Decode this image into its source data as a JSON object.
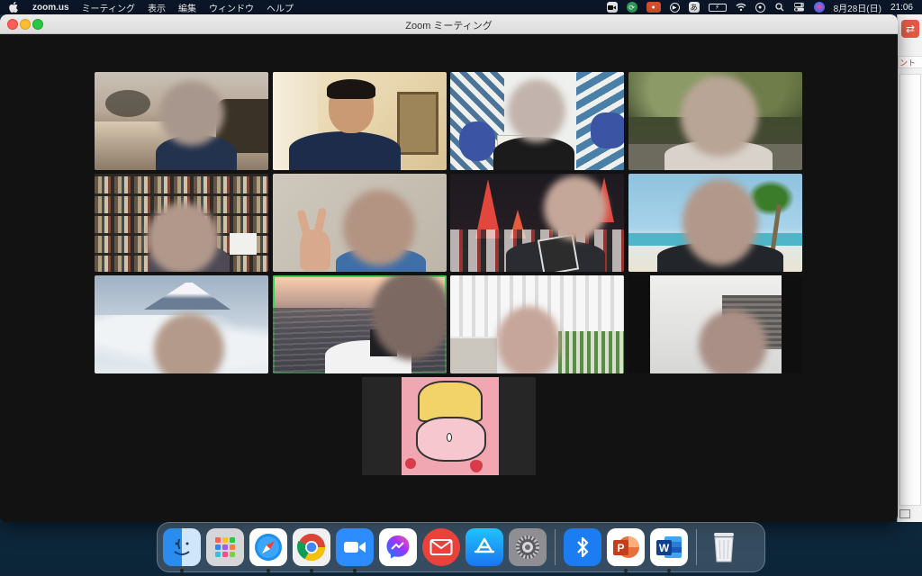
{
  "menubar": {
    "app_name": "zoom.us",
    "menus": [
      "ミーティング",
      "表示",
      "編集",
      "ウィンドウ",
      "ヘルプ"
    ],
    "status_icons": [
      "camera-icon",
      "sync-icon",
      "mic-indicator-icon",
      "play-circle-icon",
      "input-method-icon",
      "battery-icon",
      "wifi-icon",
      "user-icon",
      "spotlight-icon",
      "control-center-icon",
      "siri-icon"
    ],
    "date": "8月28日(日)",
    "time": "21:06"
  },
  "zoom_window": {
    "title": "Zoom ミーティング",
    "participants": [
      {
        "row": 1,
        "col": 1,
        "background": "sunset-bay"
      },
      {
        "row": 1,
        "col": 2,
        "background": "room"
      },
      {
        "row": 1,
        "col": 3,
        "background": "leaf-pattern"
      },
      {
        "row": 1,
        "col": 4,
        "background": "forest"
      },
      {
        "row": 2,
        "col": 1,
        "background": "bookshelf"
      },
      {
        "row": 2,
        "col": 2,
        "background": "plain-wall"
      },
      {
        "row": 2,
        "col": 3,
        "background": "lantern-festival"
      },
      {
        "row": 2,
        "col": 4,
        "background": "tropical-beach"
      },
      {
        "row": 3,
        "col": 1,
        "background": "mount-fuji"
      },
      {
        "row": 3,
        "col": 2,
        "background": "ocean-sunset",
        "active_speaker": true
      },
      {
        "row": 3,
        "col": 3,
        "background": "curtain"
      },
      {
        "row": 3,
        "col": 4,
        "background": "dark-room"
      },
      {
        "row": 4,
        "col": 1,
        "background": "pink-cartoon"
      }
    ]
  },
  "background_window": {
    "tab_label": "ント"
  },
  "dock": {
    "apps": [
      {
        "name": "Finder",
        "icon": "finder-icon",
        "running": true
      },
      {
        "name": "Launchpad",
        "icon": "launchpad-icon",
        "running": false
      },
      {
        "name": "Safari",
        "icon": "safari-icon",
        "running": true
      },
      {
        "name": "Google Chrome",
        "icon": "chrome-icon",
        "running": true
      },
      {
        "name": "Zoom",
        "icon": "zoom-icon",
        "running": true
      },
      {
        "name": "Messenger",
        "icon": "messenger-icon",
        "running": false
      },
      {
        "name": "Mail",
        "icon": "mail-icon",
        "running": false
      },
      {
        "name": "App Store",
        "icon": "app-store-icon",
        "running": false
      },
      {
        "name": "System Preferences",
        "icon": "system-preferences-icon",
        "running": false
      },
      {
        "name": "Bluetooth",
        "icon": "bluetooth-icon",
        "running": false
      },
      {
        "name": "PowerPoint",
        "icon": "powerpoint-icon",
        "running": true
      },
      {
        "name": "Word",
        "icon": "word-icon",
        "running": true
      },
      {
        "name": "Trash",
        "icon": "trash-icon",
        "running": false
      }
    ]
  }
}
